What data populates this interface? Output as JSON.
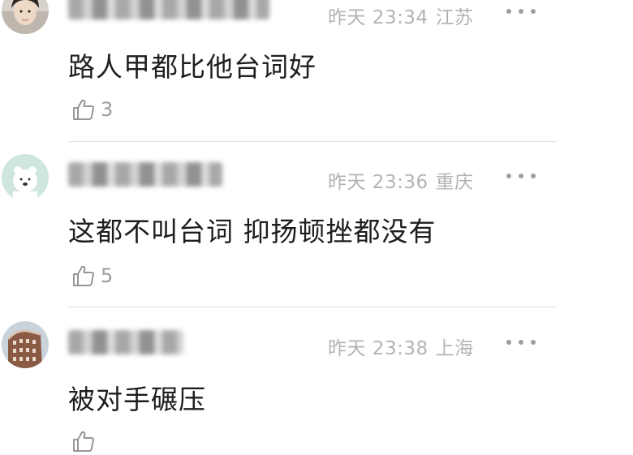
{
  "comments": [
    {
      "time": "昨天 23:34",
      "location": "江苏",
      "text": "路人甲都比他台词好",
      "likes": "3",
      "avatar_icon": "young-man-photo-avatar"
    },
    {
      "time": "昨天 23:36",
      "location": "重庆",
      "text": "这都不叫台词 抑扬顿挫都没有",
      "likes": "5",
      "avatar_icon": "polar-bear-cartoon-avatar"
    },
    {
      "time": "昨天 23:38",
      "location": "上海",
      "text": "被对手碾压",
      "likes": "",
      "avatar_icon": "building-photo-avatar"
    }
  ],
  "icons": {
    "more": "ellipsis-icon",
    "like": "thumbs-up-icon"
  },
  "colors": {
    "meta_text": "#b3b3b3",
    "comment_text": "#1e1e1e",
    "like_count": "#9c9c9c",
    "divider": "#e2e2e2"
  }
}
